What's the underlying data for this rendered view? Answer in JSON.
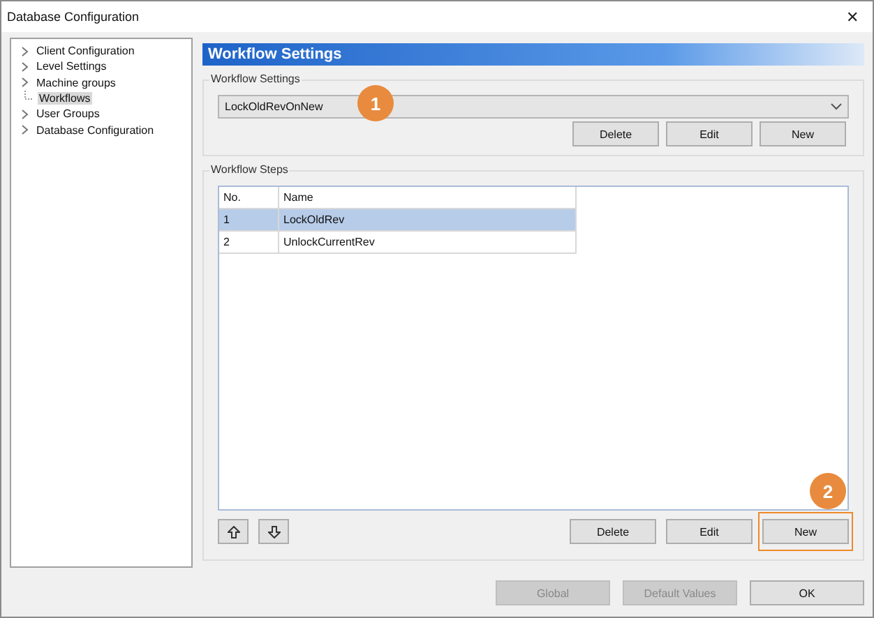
{
  "window": {
    "title": "Database Configuration",
    "close": "✕"
  },
  "sidebar": {
    "items": [
      {
        "label": "Client Configuration",
        "expandable": true,
        "selected": false
      },
      {
        "label": "Level Settings",
        "expandable": true,
        "selected": false
      },
      {
        "label": "Machine groups",
        "expandable": true,
        "selected": false
      },
      {
        "label": "Workflows",
        "expandable": false,
        "selected": true
      },
      {
        "label": "User Groups",
        "expandable": true,
        "selected": false
      },
      {
        "label": "Database Configuration",
        "expandable": true,
        "selected": false
      }
    ]
  },
  "header": "Workflow Settings",
  "settings_group": {
    "title": "Workflow Settings",
    "dropdown": {
      "value": "LockOldRevOnNew"
    },
    "callout": "1",
    "buttons": [
      {
        "label": "Delete"
      },
      {
        "label": "Edit"
      },
      {
        "label": "New"
      }
    ]
  },
  "steps_group": {
    "title": "Workflow Steps",
    "table": {
      "columns": [
        "No.",
        "Name"
      ],
      "rows": [
        {
          "cells": [
            "1",
            "LockOldRev"
          ],
          "selected": true
        },
        {
          "cells": [
            "2",
            "UnlockCurrentRev"
          ],
          "selected": false
        }
      ]
    },
    "callout": "2",
    "buttons": [
      {
        "label": "Delete",
        "highlighted": false
      },
      {
        "label": "Edit",
        "highlighted": false
      },
      {
        "label": "New",
        "highlighted": true
      }
    ]
  },
  "footer_buttons": [
    {
      "label": "Global",
      "disabled": true
    },
    {
      "label": "Default Values",
      "disabled": true
    },
    {
      "label": "OK",
      "disabled": false
    }
  ]
}
